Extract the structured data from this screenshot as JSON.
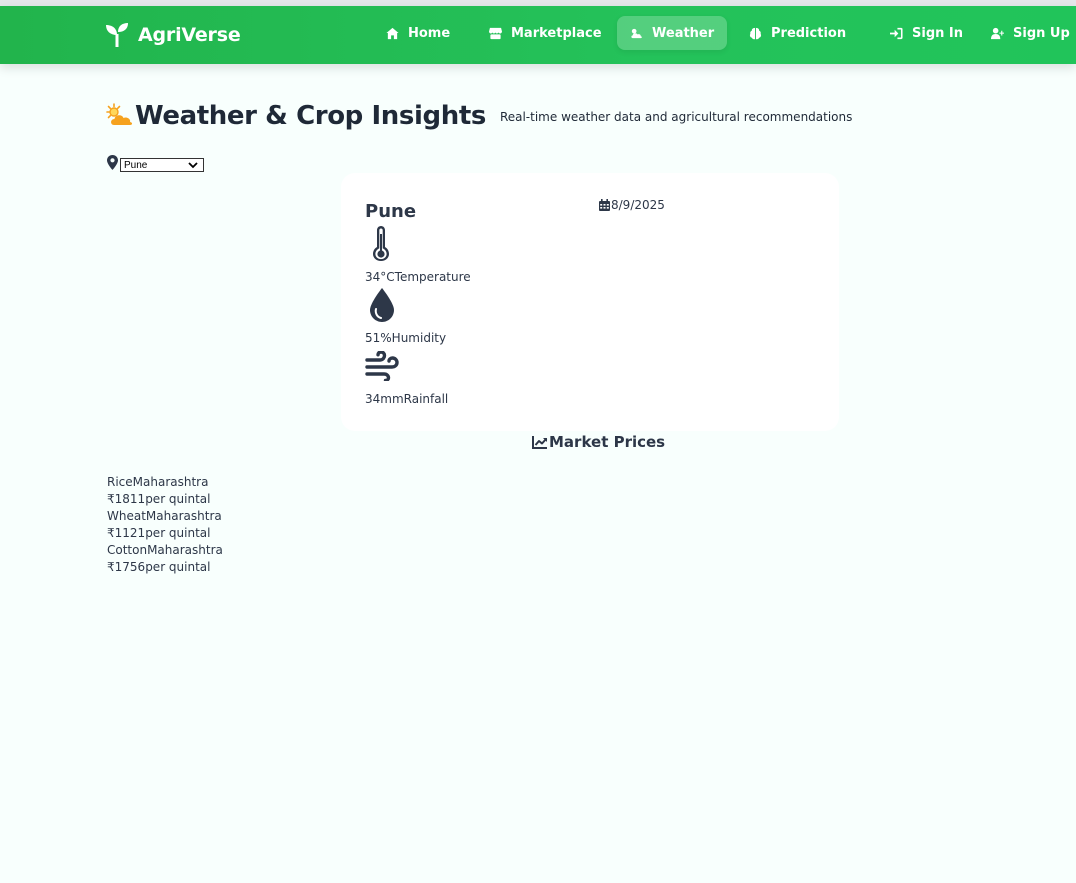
{
  "app": {
    "name": "AgriVerse"
  },
  "nav": {
    "home": "Home",
    "marketplace": "Marketplace",
    "weather": "Weather",
    "prediction": "Prediction",
    "sign_in": "Sign In",
    "sign_up": "Sign Up",
    "active": "weather"
  },
  "page": {
    "title": "Weather & Crop Insights",
    "subtitle": "Real-time weather data and agricultural recommendations"
  },
  "location": {
    "selected": "Pune"
  },
  "weather": {
    "city": "Pune",
    "date": "8/9/2025",
    "temperature": {
      "value": "34°C",
      "label": "Temperature",
      "icon": "thermometer-icon"
    },
    "humidity": {
      "value": "51%",
      "label": "Humidity",
      "icon": "droplet-icon"
    },
    "rainfall": {
      "value": "34mm",
      "label": "Rainfall",
      "icon": "wind-icon"
    }
  },
  "market": {
    "heading": "Market Prices",
    "items": [
      {
        "crop": "Rice",
        "state": "Maharashtra",
        "price": "₹1811",
        "unit": "per quintal"
      },
      {
        "crop": "Wheat",
        "state": "Maharashtra",
        "price": "₹1121",
        "unit": "per quintal"
      },
      {
        "crop": "Cotton",
        "state": "Maharashtra",
        "price": "₹1756",
        "unit": "per quintal"
      }
    ]
  },
  "colors": {
    "nav_green": "#22b44c",
    "text_dark": "#2d3748",
    "title_icon_orange": "#f6a21e",
    "background": "#f8fffd"
  }
}
